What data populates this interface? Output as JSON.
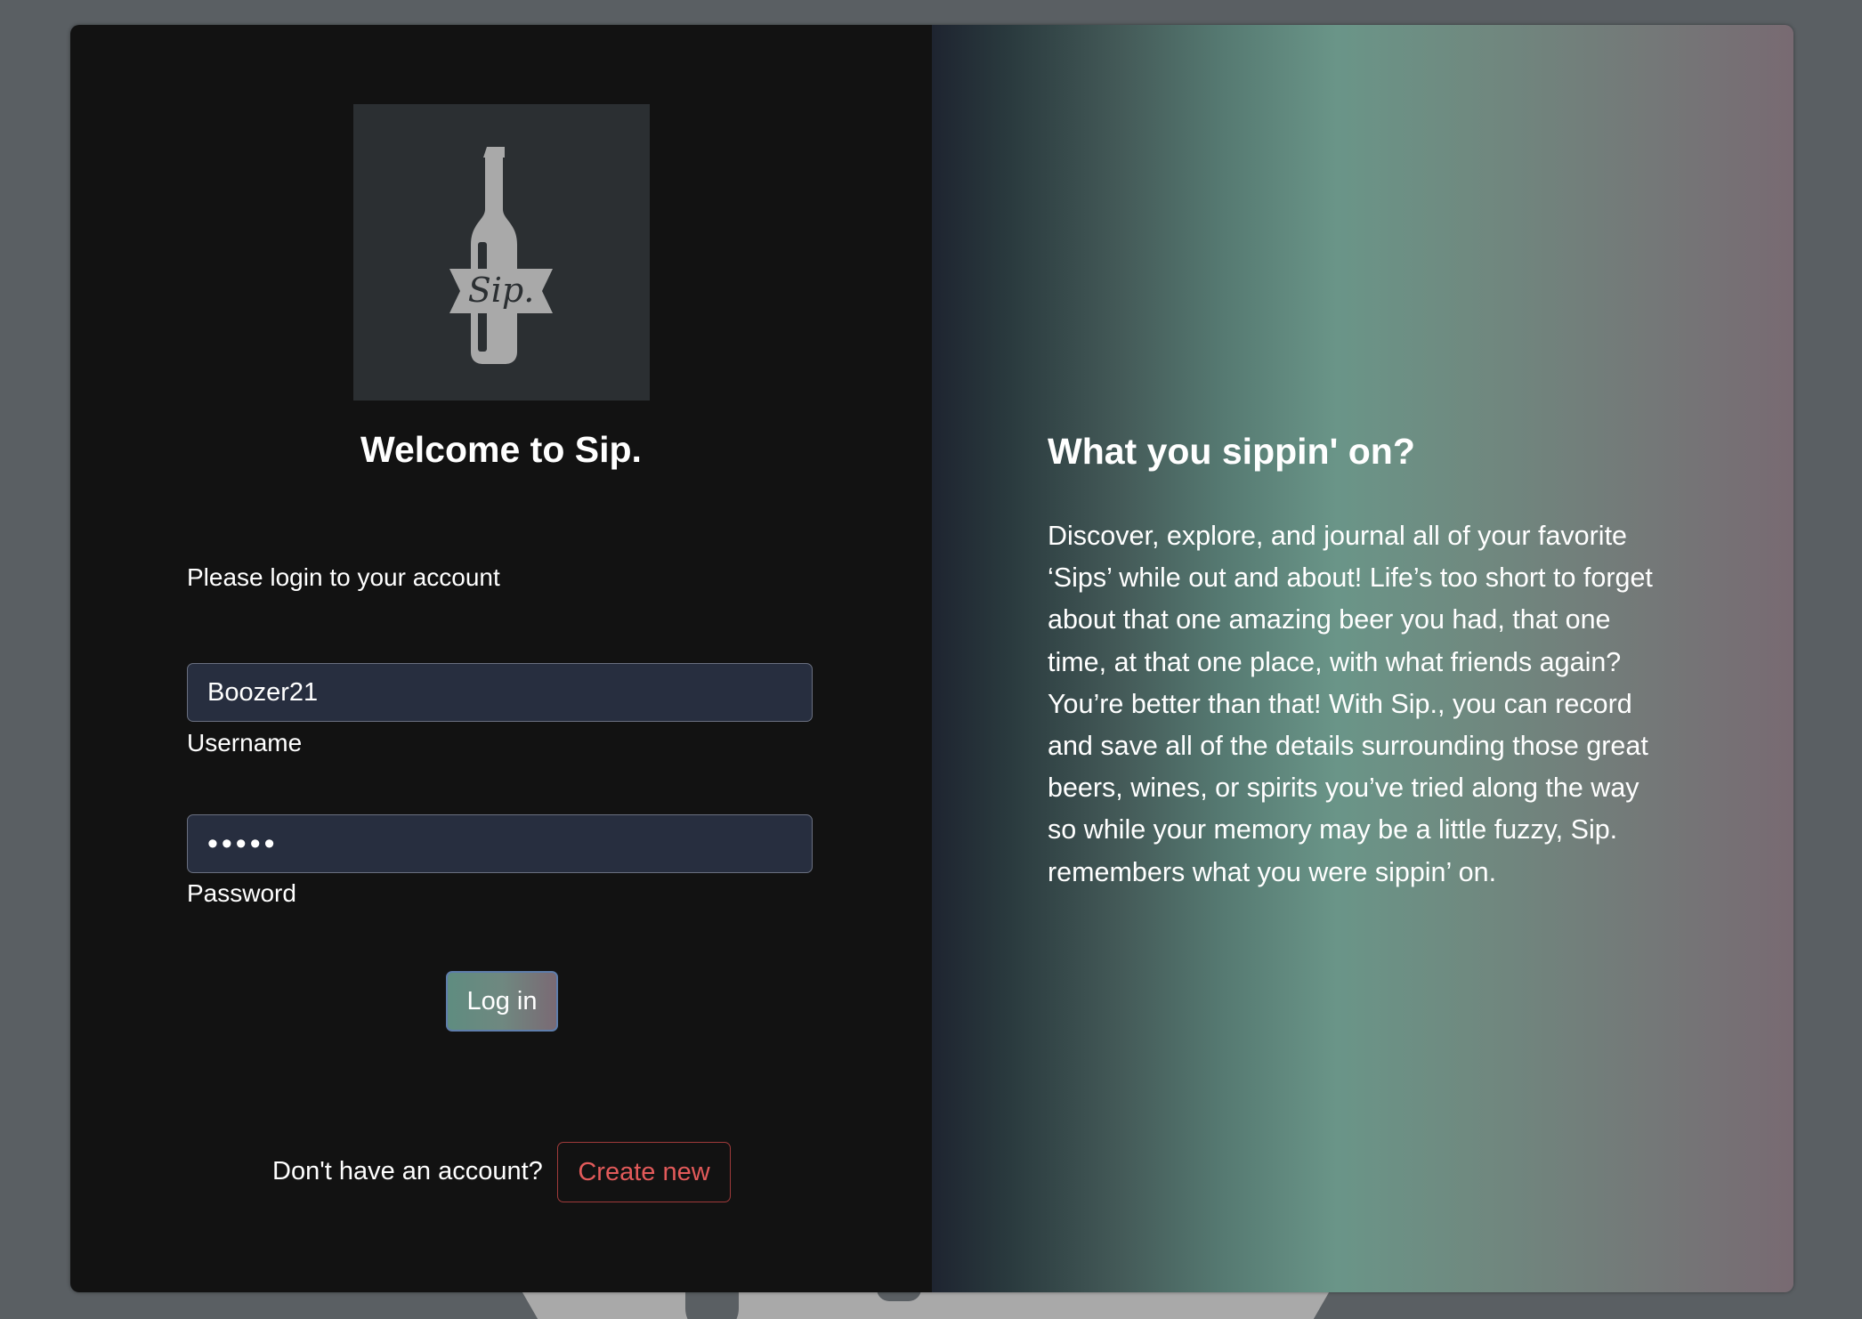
{
  "login": {
    "welcome_title": "Welcome to Sip.",
    "subtitle": "Please login to your account",
    "username_value": "Boozer21",
    "username_label": "Username",
    "password_value": "•••••",
    "password_label": "Password",
    "login_button": "Log in",
    "signup_prompt": "Don't have an account?",
    "create_button": "Create new"
  },
  "logo": {
    "icon": "wine-bottle-icon",
    "text": "Sip."
  },
  "promo": {
    "heading": "What you sippin' on?",
    "body": "Discover, explore, and journal all of your favorite ‘Sips’ while out and about! Life’s too short to forget about that one amazing beer you had, that one time, at that one place, with what friends again? You’re better than that! With Sip., you can record and save all of the details surrounding those great beers, wines, or spirits you’ve tried along the way so while your memory may be a little fuzzy, Sip. remembers what you were sippin’ on."
  },
  "colors": {
    "accent_create": "#e25a5a",
    "panel_dark": "#121212",
    "input_bg": "#272e3f"
  }
}
